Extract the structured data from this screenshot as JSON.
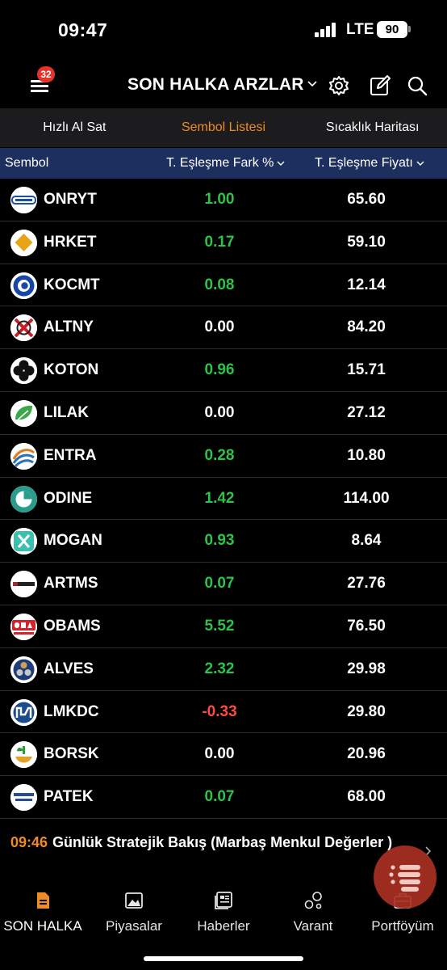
{
  "status_bar": {
    "time": "09:47",
    "network": "LTE",
    "battery": "90"
  },
  "header": {
    "menu_badge": "32",
    "title": "SON HALKA ARZLAR"
  },
  "tabs": [
    {
      "label": "Hızlı Al Sat",
      "active": false
    },
    {
      "label": "Sembol Listesi",
      "active": true
    },
    {
      "label": "Sıcaklık Haritası",
      "active": false
    }
  ],
  "table": {
    "columns": {
      "symbol": "Sembol",
      "change": "T. Eşleşme Fark %",
      "price": "T. Eşleşme Fiyatı"
    },
    "rows": [
      {
        "symbol": "ONRYT",
        "change": "1.00",
        "price": "65.60",
        "trend": "pos",
        "logo": "onur-logo-icon"
      },
      {
        "symbol": "HRKET",
        "change": "0.17",
        "price": "59.10",
        "trend": "pos",
        "logo": "hrket-logo-icon"
      },
      {
        "symbol": "KOCMT",
        "change": "0.08",
        "price": "12.14",
        "trend": "pos",
        "logo": "kocmt-logo-icon"
      },
      {
        "symbol": "ALTNY",
        "change": "0.00",
        "price": "84.20",
        "trend": "neu",
        "logo": "altny-logo-icon"
      },
      {
        "symbol": "KOTON",
        "change": "0.96",
        "price": "15.71",
        "trend": "pos",
        "logo": "koton-logo-icon"
      },
      {
        "symbol": "LILAK",
        "change": "0.00",
        "price": "27.12",
        "trend": "neu",
        "logo": "lilak-logo-icon"
      },
      {
        "symbol": "ENTRA",
        "change": "0.28",
        "price": "10.80",
        "trend": "pos",
        "logo": "entra-logo-icon"
      },
      {
        "symbol": "ODINE",
        "change": "1.42",
        "price": "114.00",
        "trend": "pos",
        "logo": "odine-logo-icon"
      },
      {
        "symbol": "MOGAN",
        "change": "0.93",
        "price": "8.64",
        "trend": "pos",
        "logo": "mogan-logo-icon"
      },
      {
        "symbol": "ARTMS",
        "change": "0.07",
        "price": "27.76",
        "trend": "pos",
        "logo": "artemis-logo-icon"
      },
      {
        "symbol": "OBAMS",
        "change": "5.52",
        "price": "76.50",
        "trend": "pos",
        "logo": "oba-logo-icon"
      },
      {
        "symbol": "ALVES",
        "change": "2.32",
        "price": "29.98",
        "trend": "pos",
        "logo": "alves-logo-icon"
      },
      {
        "symbol": "LMKDC",
        "change": "-0.33",
        "price": "29.80",
        "trend": "neg",
        "logo": "lmkdc-logo-icon"
      },
      {
        "symbol": "BORSK",
        "change": "0.00",
        "price": "20.96",
        "trend": "neu",
        "logo": "borsk-logo-icon"
      },
      {
        "symbol": "PATEK",
        "change": "0.07",
        "price": "68.00",
        "trend": "pos",
        "logo": "pasifik-logo-icon"
      }
    ]
  },
  "news": {
    "time": "09:46",
    "headline": "Günlük Stratejik Bakış (Marbaş Menkul Değerler )"
  },
  "bottom_nav": [
    {
      "label": "SON HALKA",
      "icon": "document-icon",
      "active": true
    },
    {
      "label": "Piyasalar",
      "icon": "chart-image-icon",
      "active": false
    },
    {
      "label": "Haberler",
      "icon": "news-icon",
      "active": false
    },
    {
      "label": "Varant",
      "icon": "bubbles-icon",
      "active": false
    },
    {
      "label": "Portföyüm",
      "icon": "briefcase-icon",
      "active": false
    }
  ],
  "colors": {
    "accent": "#f08a24",
    "positive": "#2fc24a",
    "negative": "#ff4b3e",
    "header_bg": "#1c2f5e",
    "fab": "#a83022"
  }
}
